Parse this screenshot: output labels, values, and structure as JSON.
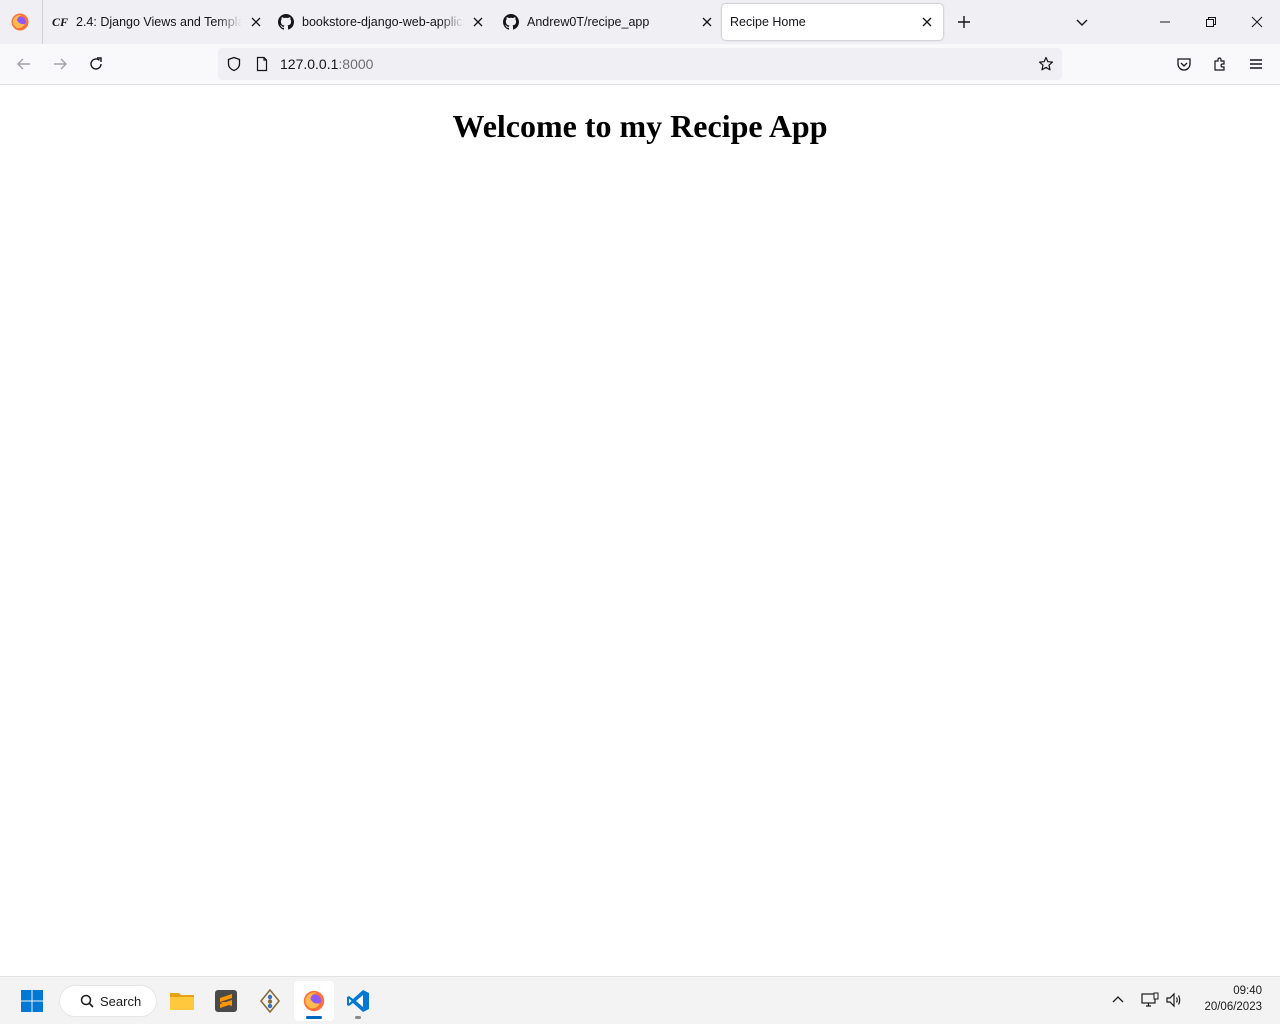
{
  "browser": {
    "tabs": [
      {
        "label": "2.4: Django Views and Template",
        "favicon": "careerfoundry-icon",
        "active": false
      },
      {
        "label": "bookstore-django-web-applica",
        "favicon": "github-icon",
        "active": false
      },
      {
        "label": "Andrew0T/recipe_app",
        "favicon": "github-icon",
        "active": false
      },
      {
        "label": "Recipe Home",
        "favicon": "none",
        "active": true
      }
    ],
    "favicon_text_cf": "CF",
    "url_host": "127.0.0.1",
    "url_port": ":8000"
  },
  "page": {
    "heading": "Welcome to my Recipe App"
  },
  "taskbar": {
    "search_label": "Search",
    "time": "09:40",
    "date": "20/06/2023"
  },
  "colors": {
    "accent": "#0061e0",
    "tabstrip_bg": "#f0f0f4",
    "navbar_bg": "#f9f9fb",
    "taskbar_bg": "#f3f3f3"
  }
}
